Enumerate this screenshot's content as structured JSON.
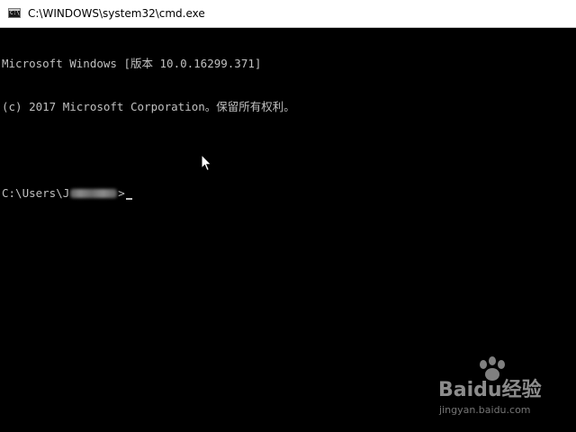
{
  "window": {
    "title": "C:\\WINDOWS\\system32\\cmd.exe",
    "icon": "cmd-console-icon",
    "icon_glyph": "C:\\"
  },
  "console": {
    "lines": [
      "Microsoft Windows [版本 10.0.16299.371]",
      "(c) 2017 Microsoft Corporation。保留所有权利。",
      ""
    ],
    "prompt": {
      "prefix": "C:\\Users\\",
      "username_visible": "J",
      "suffix": ">"
    },
    "text_color": "#c0c0c0",
    "background_color": "#000000"
  },
  "watermark": {
    "brand": "Baidu经验",
    "url": "jingyan.baidu.com"
  }
}
